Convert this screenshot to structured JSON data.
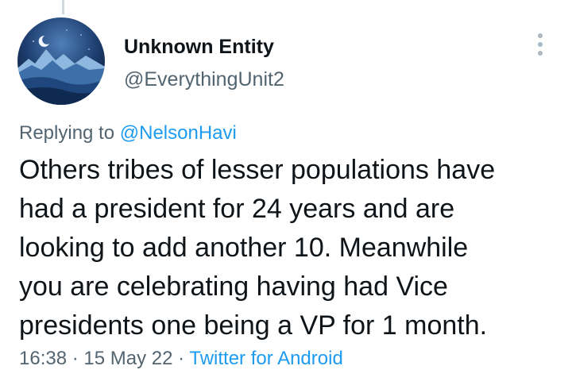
{
  "tweet": {
    "author": {
      "display_name": "Unknown Entity",
      "handle": "@EverythingUnit2",
      "avatar_icon": "night-mountain-landscape"
    },
    "replying_to_prefix": "Replying to ",
    "replying_to_handle": "@NelsonHavi",
    "text_lines": [
      "Others tribes of lesser populations have",
      "had a president for 24 years and are",
      "looking to add another 10. Meanwhile",
      "you are celebrating having had Vice",
      "presidents one being a VP for 1 month."
    ],
    "time": "16:38",
    "separator": " · ",
    "date": "15 May 22",
    "source": "Twitter for Android"
  },
  "colors": {
    "link": "#1d9bf0",
    "secondary_text": "#536471",
    "primary_text": "#0f1419",
    "thread_line": "#cfd9de"
  },
  "icons": {
    "more": "vertical-ellipsis-icon"
  }
}
